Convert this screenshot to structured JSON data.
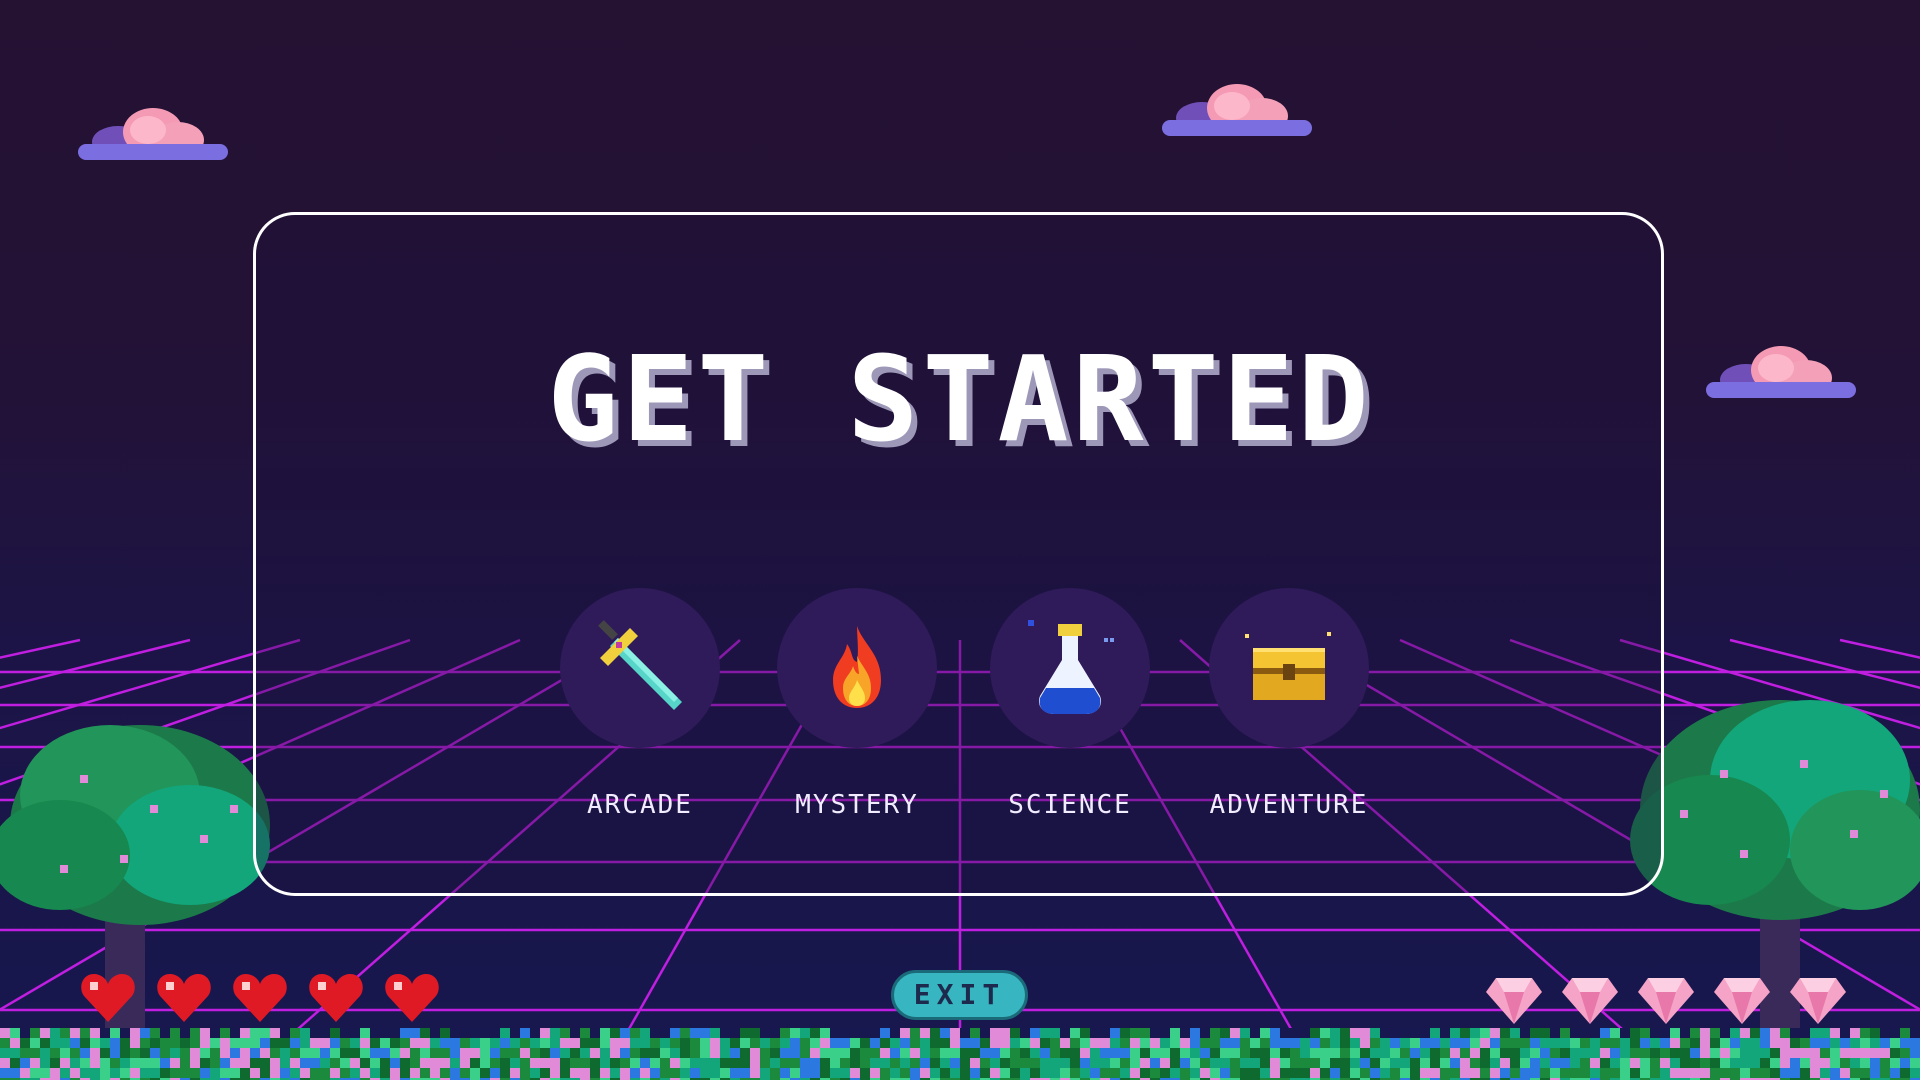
{
  "title": "GET STARTED",
  "categories": [
    {
      "label": "ARCADE",
      "icon": "sword-icon"
    },
    {
      "label": "MYSTERY",
      "icon": "fire-icon"
    },
    {
      "label": "SCIENCE",
      "icon": "potion-flask-icon"
    },
    {
      "label": "ADVENTURE",
      "icon": "treasure-chest-icon"
    }
  ],
  "lives": {
    "count": 5,
    "icon": "heart-icon",
    "color": "#e01a25"
  },
  "gems": {
    "count": 5,
    "icon": "diamond-icon",
    "color": "#f6a3c8"
  },
  "exit_label": "EXIT",
  "colors": {
    "grid": "#c01ee0",
    "panel_border": "#ffffff",
    "circle": "#2f1a5a",
    "exit_bg": "#37b5c0"
  }
}
